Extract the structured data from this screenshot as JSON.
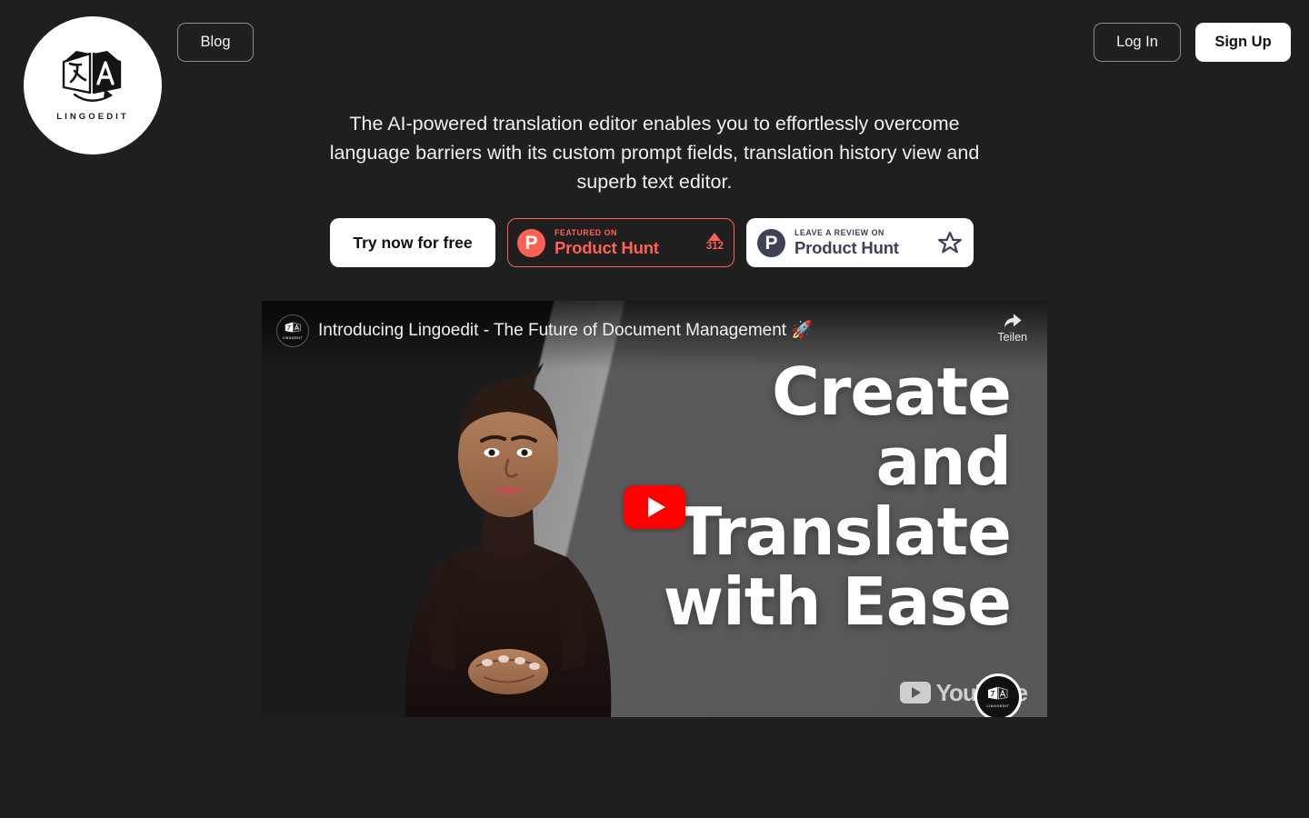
{
  "brand": {
    "logo_icon": "translation-pages-icon",
    "wordmark": "LINGOEDIT"
  },
  "header": {
    "blog_label": "Blog",
    "login_label": "Log In",
    "signup_label": "Sign Up"
  },
  "hero": {
    "subheadline": "The AI-powered translation editor enables you to effortlessly overcome language barriers with its custom prompt fields, translation history view and superb text editor."
  },
  "cta": {
    "try_label": "Try now for free",
    "product_hunt_featured": {
      "kicker": "FEATURED ON",
      "brand": "Product Hunt",
      "upvote_icon": "triangle-up-icon",
      "upvote_count": "312",
      "accent_color": "#ff6154",
      "logo_letter": "P"
    },
    "product_hunt_review": {
      "kicker": "LEAVE A REVIEW ON",
      "brand": "Product Hunt",
      "star_icon": "star-outline-icon",
      "accent_color": "#3f4156",
      "background_color": "#ffffff",
      "logo_letter": "P"
    }
  },
  "video": {
    "channel_avatar_icon": "lingoedit-channel-avatar",
    "title": "Introducing Lingoedit - The Future of Document Management 🚀",
    "share_label": "Teilen",
    "share_icon": "share-arrow-icon",
    "play_icon": "youtube-play-icon",
    "thumbnail_headline_lines": [
      "Create",
      "and",
      "Translate",
      "with Ease"
    ],
    "watermark_text": "YouTube",
    "watermark_icon": "youtube-logo-icon"
  },
  "theme": {
    "background": "#1f1f1f",
    "text": "#f0f0f0",
    "accent_coral": "#ff6154",
    "accent_slate": "#3f4156"
  }
}
